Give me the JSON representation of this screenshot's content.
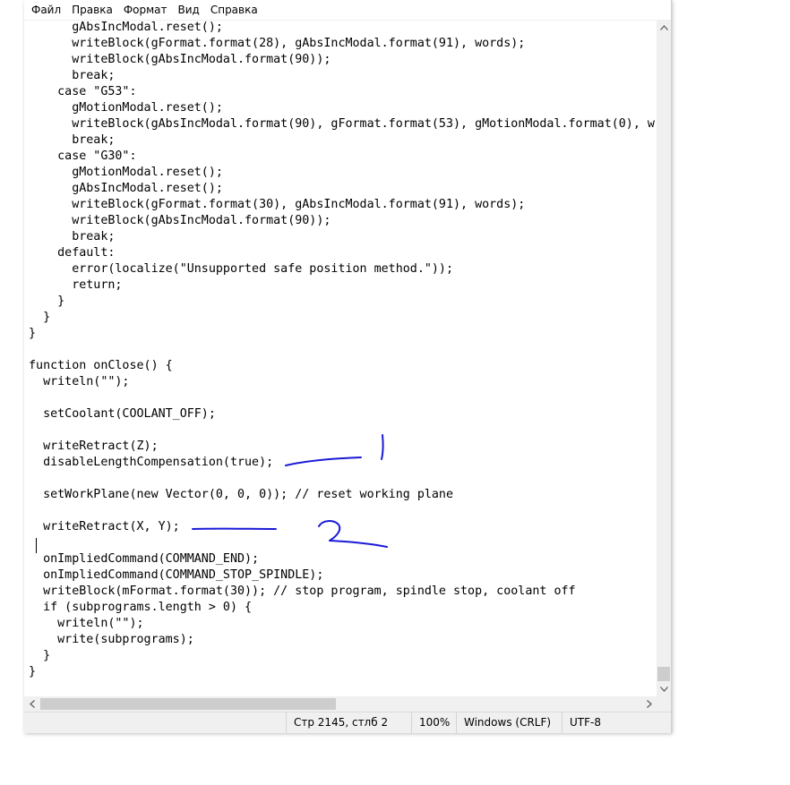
{
  "menu": {
    "items": [
      "Файл",
      "Правка",
      "Формат",
      "Вид",
      "Справка"
    ]
  },
  "editor": {
    "lines": [
      "      gAbsIncModal.reset();",
      "      writeBlock(gFormat.format(28), gAbsIncModal.format(91), words);",
      "      writeBlock(gAbsIncModal.format(90));",
      "      break;",
      "    case \"G53\":",
      "      gMotionModal.reset();",
      "      writeBlock(gAbsIncModal.format(90), gFormat.format(53), gMotionModal.format(0), w",
      "      break;",
      "    case \"G30\":",
      "      gMotionModal.reset();",
      "      gAbsIncModal.reset();",
      "      writeBlock(gFormat.format(30), gAbsIncModal.format(91), words);",
      "      writeBlock(gAbsIncModal.format(90));",
      "      break;",
      "    default:",
      "      error(localize(\"Unsupported safe position method.\"));",
      "      return;",
      "    }",
      "  }",
      "}",
      "",
      "function onClose() {",
      "  writeln(\"\");",
      "",
      "  setCoolant(COOLANT_OFF);",
      "",
      "  writeRetract(Z);",
      "  disableLengthCompensation(true);",
      "",
      "  setWorkPlane(new Vector(0, 0, 0)); // reset working plane",
      "",
      "  writeRetract(X, Y);",
      "",
      "  onImpliedCommand(COMMAND_END);",
      "  onImpliedCommand(COMMAND_STOP_SPINDLE);",
      "  writeBlock(mFormat.format(30)); // stop program, spindle stop, coolant off",
      "  if (subprograms.length > 0) {",
      "    writeln(\"\");",
      "    write(subprograms);",
      "  }",
      "}"
    ]
  },
  "status": {
    "position": "Стр 2145, стлб 2",
    "zoom": "100%",
    "line_endings": "Windows (CRLF)",
    "encoding": "UTF-8"
  },
  "annotations": {
    "ink_color": "#1a1ad6",
    "mark_1": "1",
    "mark_2": "2"
  },
  "icons": [
    "scroll-up-arrow-icon",
    "scroll-down-arrow-icon",
    "scroll-left-arrow-icon",
    "scroll-right-arrow-icon"
  ]
}
